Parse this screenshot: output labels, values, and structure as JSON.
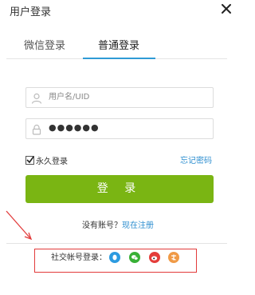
{
  "dialog": {
    "title": "用户登录",
    "close_icon": "close-icon"
  },
  "tabs": [
    {
      "label": "微信登录",
      "active": false
    },
    {
      "label": "普通登录",
      "active": true
    }
  ],
  "form": {
    "username_placeholder": "用户名/UID",
    "password_value": "●●●●●●",
    "remember_label": "永久登录",
    "remember_checked": true,
    "forgot_label": "忘记密码",
    "login_button": "登 录"
  },
  "register": {
    "prompt": "没有账号？",
    "link_label": "现在注册"
  },
  "social": {
    "label": "社交帐号登录：",
    "icons": [
      "qq-icon",
      "wechat-icon",
      "weibo-icon",
      "toutiao-icon"
    ]
  },
  "colors": {
    "accent": "#2f9bd6",
    "login_button": "#7ab513",
    "link": "#2f8fd0",
    "annotation": "#e23b3b"
  }
}
